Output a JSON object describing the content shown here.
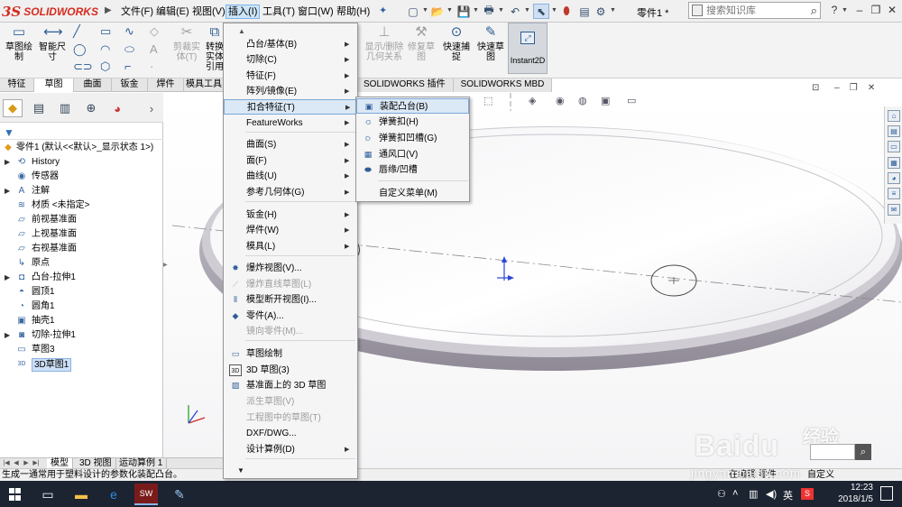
{
  "app": {
    "logo_text": "SOLIDWORKS",
    "menus": [
      "文件(F)",
      "编辑(E)",
      "视图(V)",
      "插入(I)",
      "工具(T)",
      "窗口(W)",
      "帮助(H)"
    ],
    "part_name": "零件1 *",
    "search_placeholder": "搜索知识库",
    "help_label": "?"
  },
  "command_manager": {
    "buttons": [
      {
        "label": "草图绘制"
      },
      {
        "label": "智能尺寸"
      },
      {
        "label": "剪裁实体(T)"
      },
      {
        "label": "转换实体引用"
      },
      {
        "label": "显示/删除几何关系"
      },
      {
        "label": "修复草图"
      },
      {
        "label": "快速捕捉"
      },
      {
        "label": "快速草图"
      },
      {
        "label": "Instant2D"
      }
    ],
    "tabs": [
      "特征",
      "草图",
      "曲面",
      "钣金",
      "焊件",
      "模具工具"
    ],
    "active_tab": "草图",
    "tabs_right": [
      "SOLIDWORKS 插件",
      "SOLIDWORKS MBD"
    ]
  },
  "tree": {
    "root": "零件1 (默认<<默认>_显示状态 1>)",
    "items": [
      {
        "label": "History",
        "icon": "history-icon",
        "expander": true
      },
      {
        "label": "传感器",
        "icon": "sensor-icon",
        "expander": false
      },
      {
        "label": "注解",
        "icon": "annotation-icon",
        "expander": true
      },
      {
        "label": "材质 <未指定>",
        "icon": "material-icon",
        "expander": false
      },
      {
        "label": "前视基准面",
        "icon": "plane-icon",
        "expander": false
      },
      {
        "label": "上视基准面",
        "icon": "plane-icon",
        "expander": false
      },
      {
        "label": "右视基准面",
        "icon": "plane-icon",
        "expander": false
      },
      {
        "label": "原点",
        "icon": "origin-icon",
        "expander": false
      },
      {
        "label": "凸台-拉伸1",
        "icon": "extrude-icon",
        "expander": true
      },
      {
        "label": "圆顶1",
        "icon": "dome-icon",
        "expander": false
      },
      {
        "label": "圆角1",
        "icon": "fillet-icon",
        "expander": false
      },
      {
        "label": "抽壳1",
        "icon": "shell-icon",
        "expander": false
      },
      {
        "label": "切除-拉伸1",
        "icon": "cut-extrude-icon",
        "expander": true
      },
      {
        "label": "草图3",
        "icon": "sketch-icon",
        "expander": false
      },
      {
        "label": "3D草图1",
        "icon": "3d-sketch-icon",
        "expander": false,
        "selected": true
      }
    ]
  },
  "bottom_tabs": [
    "模型",
    "3D 视图",
    "运动算例 1"
  ],
  "status": {
    "text": "生成一通常用于塑料设计的参数化装配凸台。",
    "right1": "在编辑 零件",
    "right2": "自定义"
  },
  "insert_menu": {
    "items": [
      {
        "label": "凸台/基体(B)",
        "arrow": true,
        "disabled": false,
        "icon": ""
      },
      {
        "label": "切除(C)",
        "arrow": true,
        "disabled": false,
        "icon": ""
      },
      {
        "label": "特征(F)",
        "arrow": true,
        "disabled": false,
        "icon": ""
      },
      {
        "label": "阵列/镜像(E)",
        "arrow": true,
        "disabled": false,
        "icon": ""
      },
      {
        "label": "扣合特征(T)",
        "arrow": true,
        "disabled": false,
        "icon": "",
        "hover": true
      },
      {
        "label": "FeatureWorks",
        "arrow": true,
        "disabled": false,
        "icon": ""
      },
      {
        "label": "曲面(S)",
        "arrow": true,
        "disabled": false,
        "icon": ""
      },
      {
        "label": "面(F)",
        "arrow": true,
        "disabled": false,
        "icon": ""
      },
      {
        "label": "曲线(U)",
        "arrow": true,
        "disabled": false,
        "icon": ""
      },
      {
        "label": "参考几何体(G)",
        "arrow": true,
        "disabled": false,
        "icon": ""
      },
      {
        "label": "钣金(H)",
        "arrow": true,
        "disabled": false,
        "icon": ""
      },
      {
        "label": "焊件(W)",
        "arrow": true,
        "disabled": false,
        "icon": ""
      },
      {
        "label": "模具(L)",
        "arrow": true,
        "disabled": false,
        "icon": ""
      },
      {
        "label": "爆炸视图(V)...",
        "arrow": false,
        "disabled": false,
        "icon": "explode-view-icon"
      },
      {
        "label": "爆炸直线草图(L)",
        "arrow": false,
        "disabled": true,
        "icon": "explode-line-icon"
      },
      {
        "label": "模型断开视图(I)...",
        "arrow": false,
        "disabled": false,
        "icon": "break-view-icon"
      },
      {
        "label": "零件(A)...",
        "arrow": false,
        "disabled": false,
        "icon": "part-icon"
      },
      {
        "label": "镜向零件(M)...",
        "arrow": false,
        "disabled": true,
        "icon": ""
      },
      {
        "label": "草图绘制",
        "arrow": false,
        "disabled": false,
        "icon": "sketch-icon"
      },
      {
        "label": "3D 草图(3)",
        "arrow": false,
        "disabled": false,
        "icon": "3d-sketch-icon"
      },
      {
        "label": "基准面上的 3D 草图",
        "arrow": false,
        "disabled": false,
        "icon": "3d-sketch-plane-icon"
      },
      {
        "label": "派生草图(V)",
        "arrow": false,
        "disabled": true,
        "icon": ""
      },
      {
        "label": "工程图中的草图(T)",
        "arrow": false,
        "disabled": true,
        "icon": ""
      },
      {
        "label": "DXF/DWG...",
        "arrow": false,
        "disabled": false,
        "icon": ""
      },
      {
        "label": "设计算例(D)",
        "arrow": true,
        "disabled": false,
        "icon": ""
      }
    ]
  },
  "sub_menu": {
    "items": [
      {
        "label": "装配凸台(B)",
        "icon": "mounting-boss-icon",
        "hover": true
      },
      {
        "label": "弹簧扣(H)",
        "icon": "snap-hook-icon"
      },
      {
        "label": "弹簧扣凹槽(G)",
        "icon": "snap-hook-groove-icon"
      },
      {
        "label": "通风口(V)",
        "icon": "vent-icon"
      },
      {
        "label": "唇缘/凹槽",
        "icon": "lip-groove-icon"
      },
      {
        "label": "自定义菜单(M)",
        "icon": ""
      }
    ]
  },
  "taskbar": {
    "time": "12:23",
    "date": "2018/1/5",
    "ime": "英"
  },
  "watermark": {
    "text": "Baidu",
    "cn": "经验",
    "url": "jingyan.baidu.com"
  }
}
